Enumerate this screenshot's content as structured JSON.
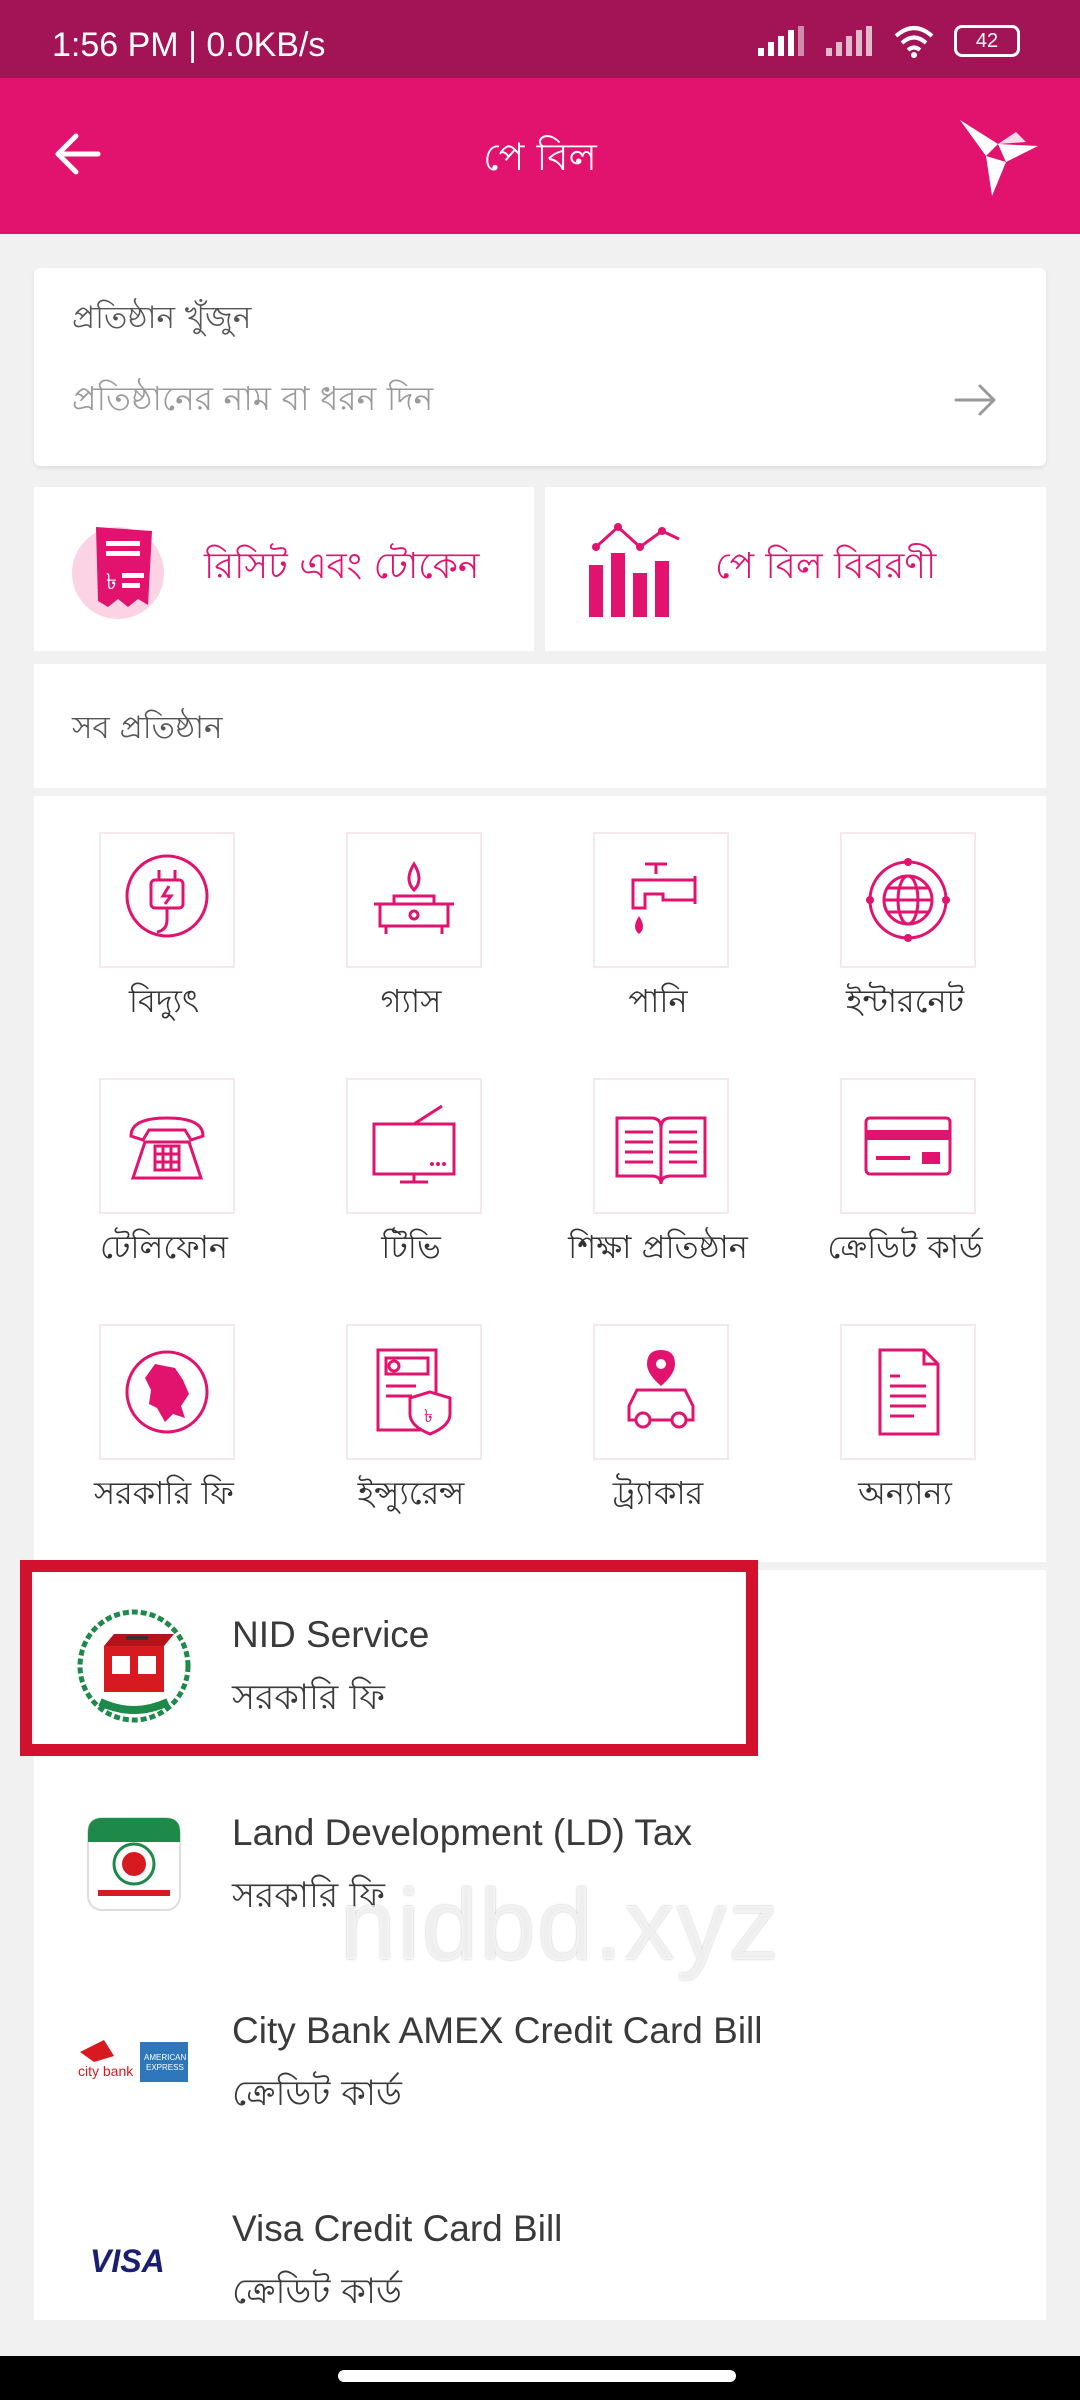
{
  "status_bar": {
    "time": "1:56 PM | 0.0KB/s",
    "battery": "42"
  },
  "app_bar": {
    "title": "পে বিল"
  },
  "search": {
    "label": "প্রতিষ্ঠান খুঁজুন",
    "placeholder": "প্রতিষ্ঠানের নাম বা ধরন দিন"
  },
  "quick_actions": [
    {
      "label": "রিসিট এবং টোকেন",
      "icon": "receipt-icon"
    },
    {
      "label": "পে বিল বিবরণী",
      "icon": "bar-chart-icon"
    }
  ],
  "all_orgs_label": "সব প্রতিষ্ঠান",
  "categories": [
    {
      "label": "বিদ্যুৎ",
      "icon": "electricity-plug-icon"
    },
    {
      "label": "গ্যাস",
      "icon": "gas-stove-icon"
    },
    {
      "label": "পানি",
      "icon": "water-tap-icon"
    },
    {
      "label": "ইন্টারনেট",
      "icon": "internet-globe-icon"
    },
    {
      "label": "টেলিফোন",
      "icon": "telephone-icon"
    },
    {
      "label": "টিভি",
      "icon": "tv-icon"
    },
    {
      "label": "শিক্ষা প্রতিষ্ঠান",
      "icon": "book-icon"
    },
    {
      "label": "ক্রেডিট কার্ড",
      "icon": "credit-card-icon"
    },
    {
      "label": "সরকারি ফি",
      "icon": "bangladesh-map-icon"
    },
    {
      "label": "ইন্স্যুরেন্স",
      "icon": "insurance-icon"
    },
    {
      "label": "ট্র্যাকার",
      "icon": "car-tracker-icon"
    },
    {
      "label": "অন্যান্য",
      "icon": "document-icon"
    }
  ],
  "billers": [
    {
      "title": "NID Service",
      "subtitle": "সরকারি ফি",
      "logo": "election-commission-logo"
    },
    {
      "title": "Land Development (LD) Tax",
      "subtitle": "সরকারি ফি",
      "logo": "land-tax-logo"
    },
    {
      "title": "City Bank AMEX Credit Card Bill",
      "subtitle": "ক্রেডিট কার্ড",
      "logo": "city-bank-amex-logo"
    },
    {
      "title": "Visa Credit Card Bill",
      "subtitle": "ক্রেডিট কার্ড",
      "logo": "visa-logo"
    }
  ],
  "watermark": "nidbd.xyz",
  "colors": {
    "brand": "#e2136e",
    "status_bar": "#a31456",
    "highlight": "#d3112f"
  }
}
